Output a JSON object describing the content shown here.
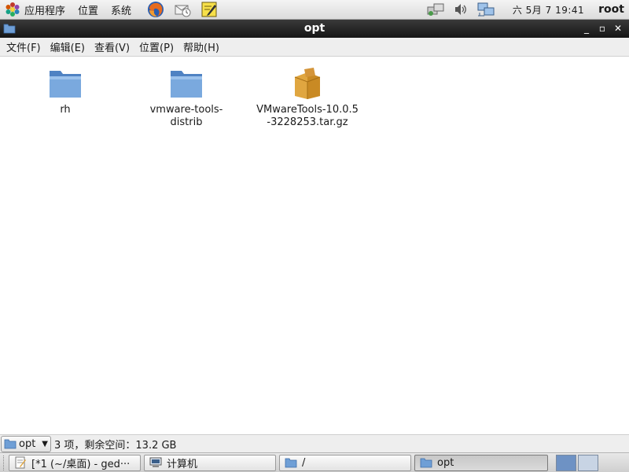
{
  "top_panel": {
    "menus": [
      "应用程序",
      "位置",
      "系统"
    ],
    "launchers": [
      "firefox-icon",
      "mail-icon",
      "note-editor-icon"
    ],
    "tray": [
      "network-display-icon",
      "volume-icon",
      "network-icon"
    ],
    "clock": "六 5月  7 19:41",
    "user": "root"
  },
  "window": {
    "title": "opt",
    "menubar": [
      "文件(F)",
      "编辑(E)",
      "查看(V)",
      "位置(P)",
      "帮助(H)"
    ]
  },
  "files": [
    {
      "name": "rh",
      "icon": "folder-icon"
    },
    {
      "name": "vmware-tools-distrib",
      "icon": "folder-icon"
    },
    {
      "name": "VMwareTools-10.0.5-3228253.tar.gz",
      "icon": "archive-icon"
    }
  ],
  "statusbar": {
    "location": "opt",
    "info": "3 项，剩余空间：13.2 GB"
  },
  "taskbar": {
    "tasks": [
      {
        "label": "[*1 (~/桌面) - ged···",
        "icon": "text-editor-icon",
        "active": false
      },
      {
        "label": "计算机",
        "icon": "computer-icon",
        "active": false
      },
      {
        "label": "/",
        "icon": "folder-icon",
        "active": false
      },
      {
        "label": "opt",
        "icon": "folder-icon",
        "active": true
      }
    ]
  },
  "colors": {
    "folder": "#6f9fd6",
    "archive": "#d89a30",
    "titlebar": "#1f1f1f"
  }
}
